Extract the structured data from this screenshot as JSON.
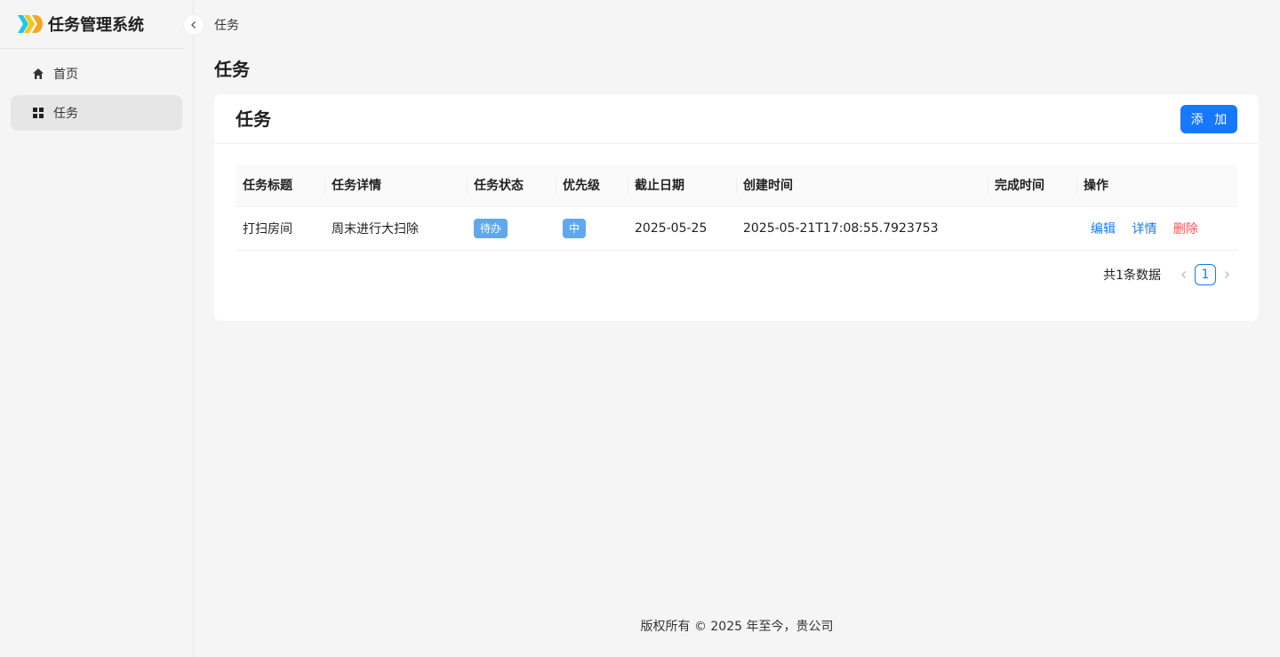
{
  "app": {
    "title": "任务管理系统"
  },
  "sidebar": {
    "items": [
      {
        "label": "首页",
        "icon": "home-icon"
      },
      {
        "label": "任务",
        "icon": "grid-icon",
        "active": true
      }
    ]
  },
  "breadcrumb": "任务",
  "page_title": "任务",
  "card": {
    "title": "任务",
    "add_label": "添 加"
  },
  "table": {
    "columns": [
      "任务标题",
      "任务详情",
      "任务状态",
      "优先级",
      "截止日期",
      "创建时间",
      "完成时间",
      "操作"
    ],
    "rows": [
      {
        "title": "打扫房间",
        "detail": "周末进行大扫除",
        "status": "待办",
        "priority": "中",
        "deadline": "2025-05-25",
        "created": "2025-05-21T17:08:55.7923753",
        "completed": "",
        "actions": {
          "edit": "编辑",
          "detail": "详情",
          "delete": "删除"
        }
      }
    ]
  },
  "pagination": {
    "total_text": "共1条数据",
    "current": "1"
  },
  "footer": "版权所有 © 2025 年至今，贵公司",
  "colors": {
    "primary": "#1677ff",
    "danger": "#ff4d4f",
    "tag": "#5fa8ef"
  }
}
